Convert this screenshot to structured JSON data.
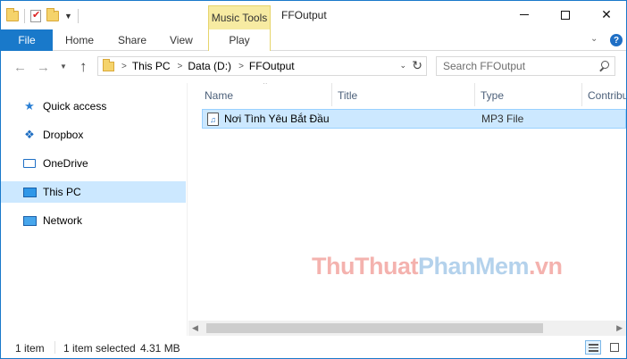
{
  "window": {
    "title": "FFOutput",
    "contextual_tab_group": "Music Tools"
  },
  "ribbon": {
    "tabs": {
      "file": "File",
      "home": "Home",
      "share": "Share",
      "view": "View",
      "play": "Play"
    },
    "help_glyph": "?"
  },
  "address_bar": {
    "breadcrumbs": [
      "This PC",
      "Data (D:)",
      "FFOutput"
    ]
  },
  "search": {
    "placeholder": "Search FFOutput"
  },
  "sidebar": {
    "items": [
      {
        "label": "Quick access",
        "icon": "star-icon"
      },
      {
        "label": "Dropbox",
        "icon": "dropbox-icon"
      },
      {
        "label": "OneDrive",
        "icon": "onedrive-icon"
      },
      {
        "label": "This PC",
        "icon": "computer-icon",
        "selected": true
      },
      {
        "label": "Network",
        "icon": "network-icon"
      }
    ]
  },
  "file_list": {
    "columns": [
      "Name",
      "Title",
      "Type",
      "Contribu"
    ],
    "rows": [
      {
        "name": "Nơi Tình Yêu Bắt Đầu",
        "title": "",
        "type": "MP3 File",
        "selected": true
      }
    ]
  },
  "status": {
    "item_count": "1 item",
    "selected": "1 item selected",
    "size": "4.31 MB"
  },
  "watermark": {
    "part1": "ThuThuat",
    "part2": "PhanMem",
    "part3": ".vn"
  },
  "colors": {
    "accent": "#1979ca",
    "selection": "#cce8ff",
    "music_tools_tab": "#f7eba2"
  }
}
